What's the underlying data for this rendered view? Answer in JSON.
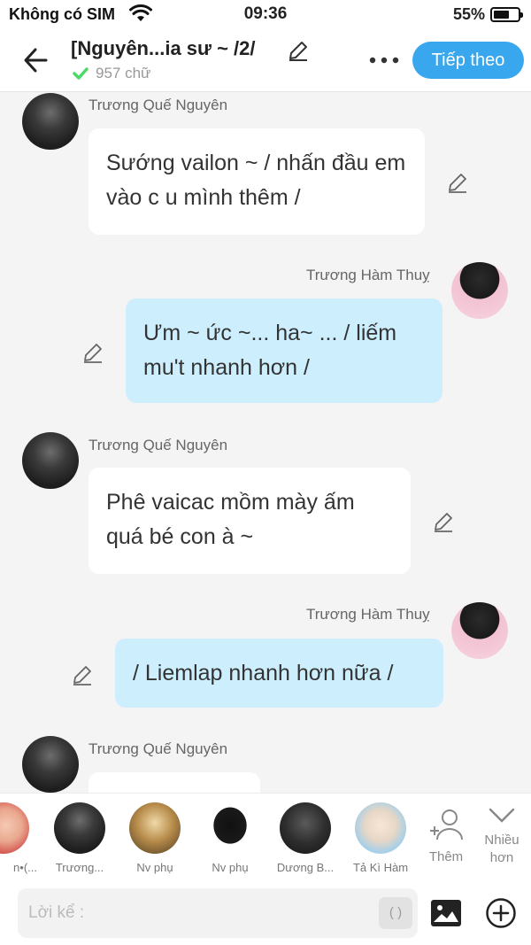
{
  "status_bar": {
    "carrier": "Không có SIM",
    "time": "09:36",
    "battery": "55%"
  },
  "header": {
    "title": "[Nguyên...ia sư ~ /2/",
    "word_count": "957 chữ",
    "next_label": "Tiếp theo"
  },
  "messages": [
    {
      "sender": "Trương Quế Nguyên",
      "side": "left",
      "text": "Sướng vailon ~ / nhấn đầu em vào c u mình thêm /"
    },
    {
      "sender": "Trương Hàm Thuỵ",
      "side": "right",
      "text": "Ưm ~ ức ~... ha~ ... / liếm mu't nhanh hơn /"
    },
    {
      "sender": "Trương Quế Nguyên",
      "side": "left",
      "text": "Phê vaicac mồm mày ấm quá bé con à ~"
    },
    {
      "sender": "Trương Hàm Thuỵ",
      "side": "right",
      "text": "/ Liemlap nhanh hơn nữa /"
    },
    {
      "sender": "Trương Quế Nguyên",
      "side": "left",
      "text": ""
    }
  ],
  "characters": [
    {
      "name": "n•(..."
    },
    {
      "name": "Trương..."
    },
    {
      "name": "Nv phụ"
    },
    {
      "name": "Nv phụ"
    },
    {
      "name": "Dương B..."
    },
    {
      "name": "Tả Kì Hàm"
    }
  ],
  "add_character_label": "Thêm",
  "more_characters_label": "Nhiều hơn",
  "input": {
    "placeholder": "Lời kể :",
    "paren_label": "( )"
  },
  "colors": {
    "accent": "#39a7ee",
    "bubble_right": "#cdeefd",
    "bubble_left": "#ffffff",
    "check": "#4cd964"
  }
}
